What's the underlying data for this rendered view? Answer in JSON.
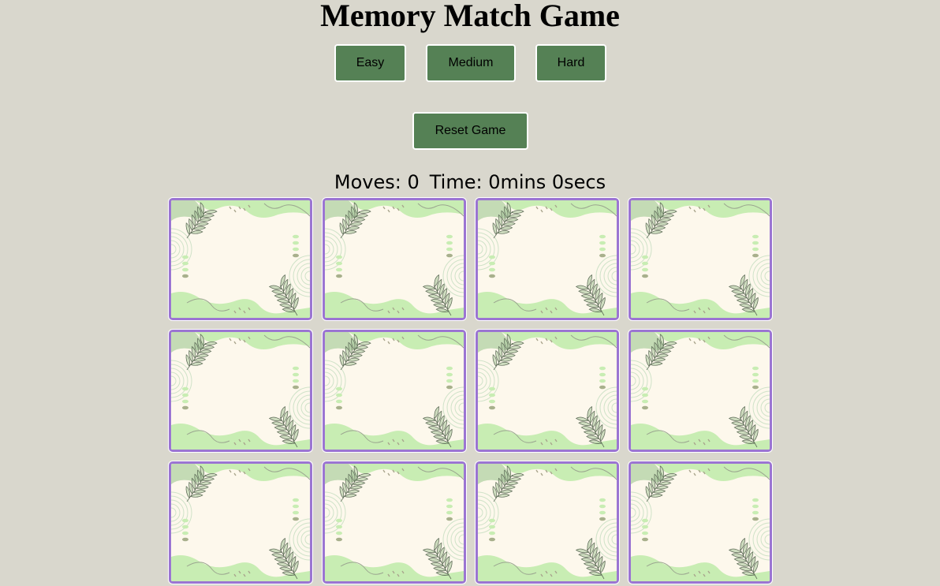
{
  "title": "Memory Match Game",
  "difficulty": {
    "easy_label": "Easy",
    "medium_label": "Medium",
    "hard_label": "Hard"
  },
  "reset_label": "Reset Game",
  "stats": {
    "moves_label": "Moves:",
    "moves_value": "0",
    "time_label": "Time:",
    "time_value": "0mins 0secs"
  },
  "board": {
    "rows": 3,
    "columns": 4,
    "cards_face_down": 12,
    "card_back_icon": "botanical-leaf-pattern"
  },
  "colors": {
    "background": "#d9d7cd",
    "button": "#558155",
    "card_border": "#9b75d2",
    "card_back": "#fdf8ec",
    "leaf_green": "#c8edb3"
  }
}
